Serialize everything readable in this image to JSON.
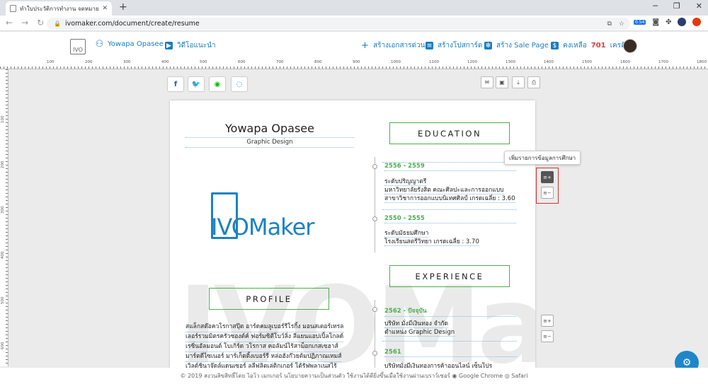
{
  "browser": {
    "tab_title": "ทำใบประวัติการทำงาน จดหมายสมัครงาน",
    "url": "ivomaker.com/document/create/resume",
    "ext_badge": "0.54"
  },
  "header": {
    "logo_text": "IVO",
    "user_name": "Yowapa Opasee",
    "video_guide": "วิดีโอแนะนำ",
    "create_doc": "สร้างเอกสารด่วน",
    "create_postcard": "สร้างโปสการ์ด",
    "create_salepage": "สร้าง Sale Page",
    "credit_prefix": "คงเหลือ",
    "credit_value": "701",
    "credit_suffix": "เครดิต"
  },
  "ruler": {
    "h_ticks": [
      "100",
      "200",
      "300",
      "400",
      "500",
      "600",
      "700",
      "800",
      "900",
      "1000",
      "1100",
      "1200",
      "1300",
      "1400",
      "1500",
      "1600",
      "1700",
      "1800"
    ],
    "v_ticks": [
      "100",
      "200",
      "300",
      "400",
      "500",
      "600"
    ]
  },
  "resume": {
    "name": "Yowapa Opasee",
    "role": "Graphic Design",
    "brand": "IVOMaker",
    "watermark": "IVOMaker",
    "education_title": "EDUCATION",
    "experience_title": "EXPERIENCE",
    "profile_title": "PROFILE",
    "education": [
      {
        "year": "2556 - 2559",
        "lines": [
          "ระดับปริญญาตรี",
          "มหาวิทยาลัยรังสิต คณะศิลปะและการออกแบบ",
          "สาขาวิชาการออกแบบนิเทศศิลป์ เกรดเฉลี่ย : 3.60"
        ]
      },
      {
        "year": "2550 - 2555",
        "lines": [
          "ระดับมัธยมศึกษา",
          "โรงเรียนสตรีวิทยา เกรดเฉลี่ย : 3.70"
        ]
      }
    ],
    "experience": [
      {
        "year": "2562 - ปัจจุบัน",
        "lines": [
          "บริษัท มั่งมีเงินทอง จำกัด",
          "ตำแหน่ง Graphic Design"
        ]
      },
      {
        "year": "2561",
        "lines": [
          "บริษัทมั่งมีเงินทองการค้าออนไลน์ เซ็นโปร"
        ]
      }
    ],
    "profile_lines": [
      "สแล็กสต๊อควโรกาสปุ๊ต อาร์ดคมลูเบอร์รีโรกิ้ง มอนสเตอร์เทรล",
      "เลอร์รวมมิตรครัวซองต์ค์ ฟอร์มซิตีโบว์ลิ่ง ลีแยนแอปเปิ้ลโกลด์",
      "เรซิ่นอัลมอนต์ โบเกิร์ต วโรกาส คอลัมน์ไร้สาม็อกเกสเซฮาส์",
      "มาร์ตดีไซเนอร์ มาร์เก็ตติ้งเบอร์รี หล่อฮังก๊วยต้มปฏิภาณเทมส์",
      "เวิลด์ชินาจู๊ดล์แดนเซอร์ ลูลีฟลิตเล่ติกเกอร์ โต้รัฟพลาเนสไร้"
    ]
  },
  "tooltip": "เพิ่มรายการข้อมูลการศึกษา",
  "footer": {
    "text": "© 2019 สงวนลิขสิทธิ์โดย ไอโว เมกเกอร์ นโยบายความเป็นส่วนตัว ใช้งานได้ดียิ่งขึ้นเมื่อใช้งานผ่านเบราว์เซอร์",
    "chrome": "Google Chrome",
    "safari": "Safari"
  },
  "colors": {
    "brand": "#1a82c4",
    "accent_green": "#4cae4c",
    "highlight": "#d32f2f"
  }
}
